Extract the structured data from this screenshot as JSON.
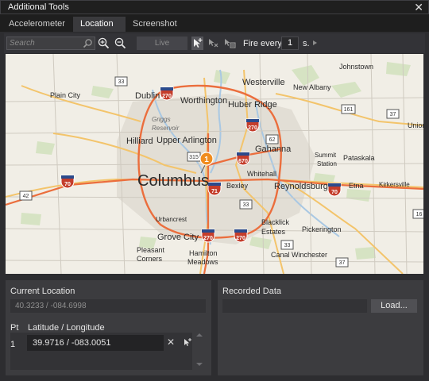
{
  "window": {
    "title": "Additional Tools",
    "close_glyph": "✕"
  },
  "tabs": [
    {
      "label": "Accelerometer",
      "active": false
    },
    {
      "label": "Location",
      "active": true
    },
    {
      "label": "Screenshot",
      "active": false
    }
  ],
  "toolbar": {
    "search_placeholder": "Search",
    "live_label": "Live",
    "fire_label": "Fire every",
    "fire_value": "1",
    "fire_unit": "s.",
    "icons": [
      "search-icon",
      "zoom-in-icon",
      "zoom-out-icon",
      "add-pin-icon",
      "clear-pins-icon",
      "clear-all-pins-icon",
      "play-icon"
    ]
  },
  "map": {
    "cities": {
      "columbus": "Columbus",
      "westerville": "Westerville",
      "worthington": "Worthington",
      "dublin": "Dublin",
      "huber_ridge": "Huber Ridge",
      "plain_city": "Plain City",
      "hilliard": "Hilliard",
      "upper_arlington": "Upper Arlington",
      "griggs_reservoir": "Griggs\nReservoir",
      "gahanna": "Gahanna",
      "new_albany": "New Albany",
      "johnstown": "Johnstown",
      "whitehall": "Whitehall",
      "bexley": "Bexley",
      "reynoldsburg": "Reynoldsburg",
      "etna": "Etna",
      "kirkersville": "Kirkersville",
      "summit_station": "Summit\nStation",
      "pataskala": "Pataskala",
      "blacklick_estates": "Blacklick\nEstates",
      "pickerington": "Pickerington",
      "urbancrest": "Urbancrest",
      "grove_city": "Grove City",
      "pleasant_corners": "Pleasant\nCorners",
      "hamilton_meadows": "Hamilton\nMeadows",
      "canal_winchester": "Canal Winchester",
      "union": "Union"
    },
    "shields": {
      "i270_nw": "270",
      "i270_n": "270",
      "i670": "670",
      "i70_w": "70",
      "i70_e": "70",
      "i71": "71",
      "i270_s": "270",
      "i270_se": "270",
      "us33_nw": "33",
      "us33_se": "33",
      "us33_s": "33",
      "r315": "315",
      "r62": "62",
      "r161": "161",
      "r37": "37",
      "r42": "42",
      "r37_r": "37",
      "r16": "16"
    },
    "pin_label": "1"
  },
  "current_location": {
    "title": "Current Location",
    "value": "40.3233 / -084.6998",
    "pt_header": "Pt",
    "latlong_header": "Latitude / Longitude",
    "rows": [
      {
        "pt": "1",
        "latlong": "39.9716 / -083.0051"
      }
    ]
  },
  "recorded_data": {
    "title": "Recorded Data",
    "value": "",
    "load_label": "Load..."
  }
}
